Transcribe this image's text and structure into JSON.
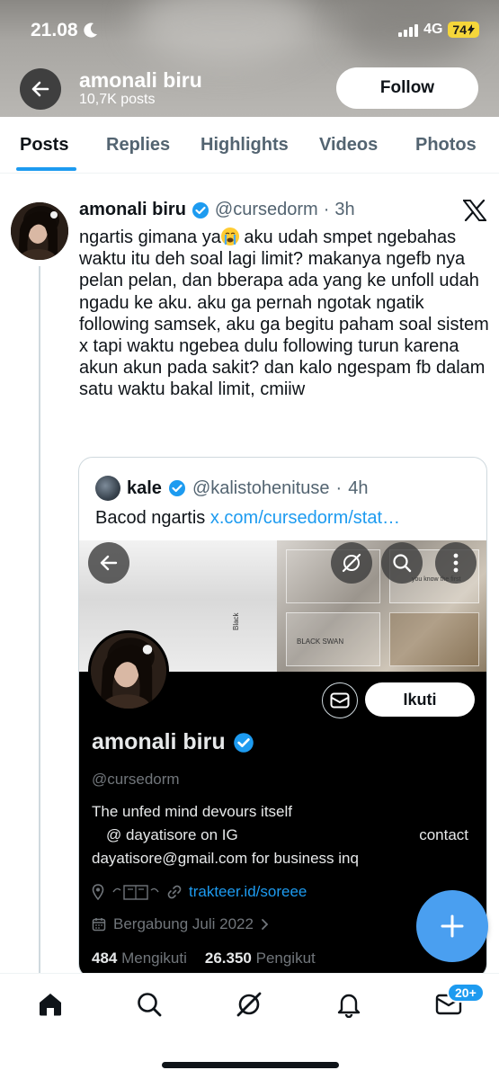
{
  "status_bar": {
    "time": "21.08",
    "network": "4G",
    "battery": "74"
  },
  "header": {
    "name": "amonali biru",
    "posts": "10,7K posts",
    "follow_label": "Follow"
  },
  "tabs": [
    "Posts",
    "Replies",
    "Highlights",
    "Videos",
    "Photos"
  ],
  "post": {
    "name": "amonali biru",
    "handle": "@cursedorm",
    "time": "3h",
    "text_before_emoji": "ngartis gimana ya",
    "text_after_emoji": " aku udah smpet ngebahas waktu itu deh soal lagi limit? makanya ngefb nya pelan pelan, dan bberapa ada yang ke unfoll udah ngadu ke aku. aku ga pernah ngotak ngatik following samsek, aku ga begitu paham soal sistem x tapi waktu ngebea dulu following turun karena akun akun pada sakit? dan kalo ngespam fb dalam satu waktu bakal limit, cmiiw"
  },
  "quote": {
    "name": "kale",
    "handle": "@kalistohenituse",
    "time": "4h",
    "text": "Bacod ngartis ",
    "link": "x.com/cursedorm/stat…"
  },
  "profile_screenshot": {
    "name": "amonali biru",
    "handle": "@cursedorm",
    "follow_label": "Ikuti",
    "bio_line1": "The unfed mind devours itself",
    "bio_line2": "@ dayatisore on IG",
    "bio_line3": "contact",
    "bio_line4": "dayatisore@gmail.com for business inq",
    "link": "trakteer.id/soreee",
    "joined": "Bergabung Juli 2022",
    "following_count": "484",
    "following_label": "Mengikuti",
    "followers_count": "26.350",
    "followers_label": "Pengikut",
    "banner_text1": "BLACK SWAN",
    "banner_text2": "you know the first",
    "banner_text3": "Black"
  },
  "nav": {
    "badge": "20+"
  },
  "colors": {
    "accent": "#1d9bf0",
    "fab": "#4a9ff0",
    "battery": "#f5d63a"
  }
}
